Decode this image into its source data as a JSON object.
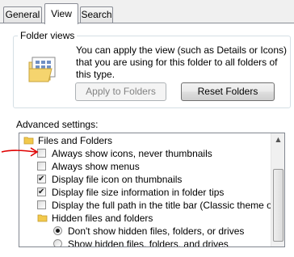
{
  "tabs": [
    {
      "label": "General",
      "active": false
    },
    {
      "label": "View",
      "active": true
    },
    {
      "label": "Search",
      "active": false
    }
  ],
  "folder_views": {
    "title": "Folder views",
    "description": "You can apply the view (such as Details or Icons) that you are using for this folder to all folders of this type.",
    "apply_button": "Apply to Folders",
    "reset_button": "Reset Folders"
  },
  "advanced": {
    "label": "Advanced settings:",
    "items": [
      {
        "type": "folder",
        "label": "Files and Folders"
      },
      {
        "type": "checkbox",
        "label": "Always show icons, never thumbnails",
        "checked": false
      },
      {
        "type": "checkbox",
        "label": "Always show menus",
        "checked": false
      },
      {
        "type": "checkbox",
        "label": "Display file icon on thumbnails",
        "checked": true
      },
      {
        "type": "checkbox",
        "label": "Display file size information in folder tips",
        "checked": true
      },
      {
        "type": "checkbox",
        "label": "Display the full path in the title bar (Classic theme only)",
        "checked": false
      },
      {
        "type": "folder",
        "label": "Hidden files and folders"
      },
      {
        "type": "radio",
        "label": "Don't show hidden files, folders, or drives",
        "checked": true
      },
      {
        "type": "radio",
        "label": "Show hidden files, folders, and drives",
        "checked": false
      }
    ]
  },
  "annotation": {
    "arrow_color": "#e00000"
  }
}
